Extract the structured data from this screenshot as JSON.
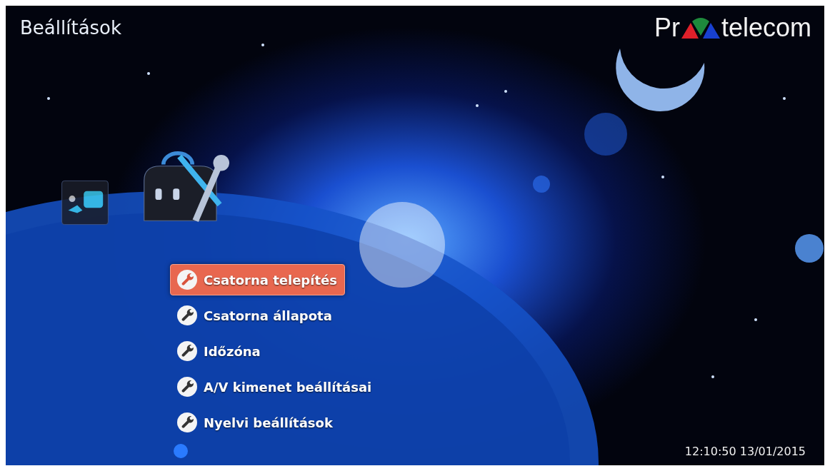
{
  "header": {
    "title": "Beállítások",
    "logo": {
      "left": "Pr",
      "right": "telecom"
    }
  },
  "categories": [
    {
      "kind": "card",
      "selected": false
    },
    {
      "kind": "toolbox",
      "selected": true
    }
  ],
  "menu": [
    {
      "label": "Csatorna telepítés",
      "selected": true
    },
    {
      "label": "Csatorna állapota",
      "selected": false
    },
    {
      "label": "Időzóna",
      "selected": false
    },
    {
      "label": "A/V kimenet beállításai",
      "selected": false
    },
    {
      "label": "Nyelvi beállítások",
      "selected": false
    }
  ],
  "status_bar": {
    "datetime": "12:10:50 13/01/2015"
  }
}
